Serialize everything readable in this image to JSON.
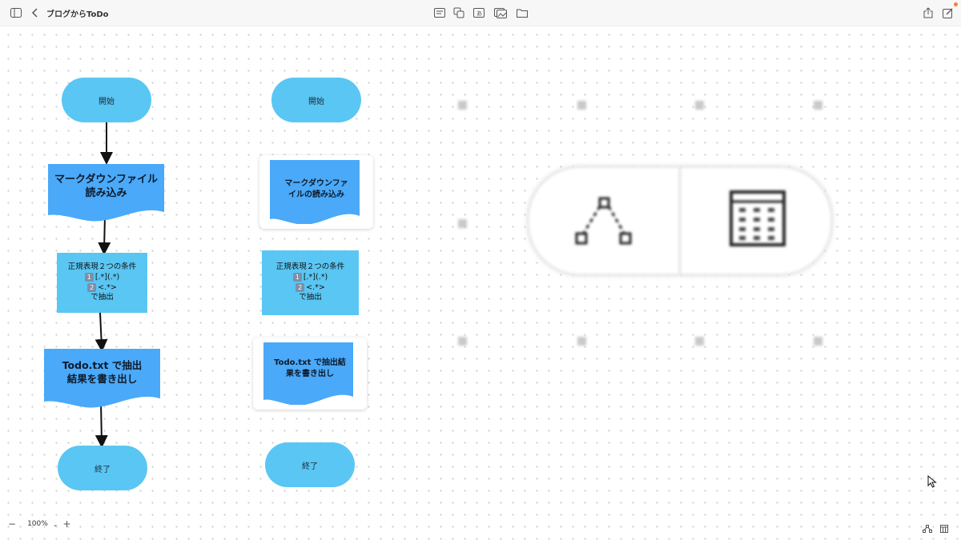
{
  "window": {
    "title": "ブログからToDo"
  },
  "toolbar": {
    "left_icons": [
      "sidebar-icon",
      "chevron-left-icon"
    ],
    "center_icons": [
      "text-card-icon",
      "copy-icon",
      "text-box-icon",
      "image-icon",
      "folder-icon"
    ],
    "right_icons": [
      "share-icon",
      "edit-icon"
    ]
  },
  "flow_left": {
    "start": "開始",
    "read_line1": "マークダウンファイル",
    "read_line2": "読み込み",
    "regex_title": "正規表現２つの条件",
    "regex_1_num": "1",
    "regex_1": "[.*](.*)",
    "regex_2_num": "2",
    "regex_2": "<.*>",
    "regex_extract": "で抽出",
    "write_line1": "Todo.txt で抽出",
    "write_line2": "結果を書き出し",
    "end": "終了"
  },
  "flow_right": {
    "start": "開始",
    "read_line1": "マークダウンファ",
    "read_line2": "イルの読み込み",
    "regex_title": "正規表現２つの条件",
    "regex_1_num": "1",
    "regex_1": "[.*](.*)",
    "regex_2_num": "2",
    "regex_2": "<.*>",
    "regex_extract": "で抽出",
    "write_line1": "Todo.txt で抽出結",
    "write_line2": "果を書き出し",
    "end": "終了"
  },
  "popover": {
    "left_icon": "diagram-icon",
    "right_icon": "table-grid-icon"
  },
  "bottom": {
    "zoom_minus": "−",
    "zoom_level": "100%",
    "zoom_plus": "+",
    "right_icons": [
      "diagram-icon",
      "table-grid-icon"
    ]
  },
  "colors": {
    "shape_fill": "#5ac6f3",
    "doc_fill": "#4aa9f8",
    "accent_dot": "#ff7a3c"
  }
}
